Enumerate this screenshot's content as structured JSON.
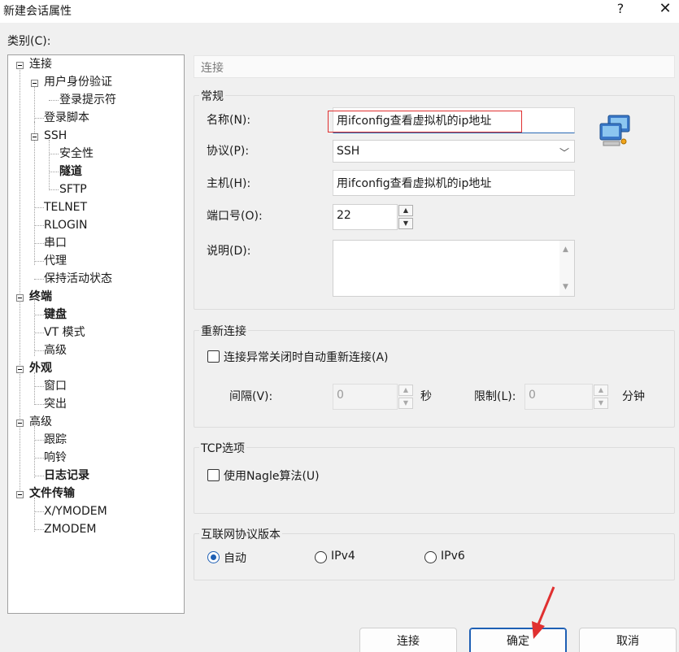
{
  "window": {
    "title": "新建会话属性",
    "help": "?",
    "close": "✕"
  },
  "category_label": "类别(C):",
  "tree": [
    {
      "label": "连接",
      "bold": true
    },
    {
      "label": "用户身份验证",
      "bold": true
    },
    {
      "label": "登录提示符",
      "bold": false
    },
    {
      "label": "登录脚本",
      "bold": false
    },
    {
      "label": "SSH",
      "bold": false
    },
    {
      "label": "安全性",
      "bold": false
    },
    {
      "label": "隧道",
      "bold": true
    },
    {
      "label": "SFTP",
      "bold": false
    },
    {
      "label": "TELNET",
      "bold": false
    },
    {
      "label": "RLOGIN",
      "bold": false
    },
    {
      "label": "串口",
      "bold": false
    },
    {
      "label": "代理",
      "bold": false
    },
    {
      "label": "保持活动状态",
      "bold": false
    },
    {
      "label": "终端",
      "bold": true
    },
    {
      "label": "键盘",
      "bold": true
    },
    {
      "label": "VT 模式",
      "bold": false
    },
    {
      "label": "高级",
      "bold": false
    },
    {
      "label": "外观",
      "bold": true
    },
    {
      "label": "窗口",
      "bold": false
    },
    {
      "label": "突出",
      "bold": false
    },
    {
      "label": "高级",
      "bold": false
    },
    {
      "label": "跟踪",
      "bold": false
    },
    {
      "label": "响铃",
      "bold": false
    },
    {
      "label": "日志记录",
      "bold": true
    },
    {
      "label": "文件传输",
      "bold": true
    },
    {
      "label": "X/YMODEM",
      "bold": false
    },
    {
      "label": "ZMODEM",
      "bold": false
    }
  ],
  "section_header": "连接",
  "general": {
    "title": "常规",
    "name_label": "名称(N):",
    "name_value": "用ifconfig查看虚拟机的ip地址",
    "protocol_label": "协议(P):",
    "protocol_value": "SSH",
    "host_label": "主机(H):",
    "host_value": "用ifconfig查看虚拟机的ip地址",
    "port_label": "端口号(O):",
    "port_value": "22",
    "desc_label": "说明(D):",
    "desc_value": ""
  },
  "reconnect": {
    "title": "重新连接",
    "checkbox_label": "连接异常关闭时自动重新连接(A)",
    "checked": false,
    "interval_label": "间隔(V):",
    "interval_value": "0",
    "interval_unit": "秒",
    "limit_label": "限制(L):",
    "limit_value": "0",
    "limit_unit": "分钟"
  },
  "tcp": {
    "title": "TCP选项",
    "nagle_label": "使用Nagle算法(U)",
    "checked": false
  },
  "ip_version": {
    "title": "互联网协议版本",
    "options": [
      "自动",
      "IPv4",
      "IPv6"
    ],
    "selected": "自动"
  },
  "buttons": {
    "connect": "连接",
    "ok": "确定",
    "cancel": "取消"
  },
  "colors": {
    "accent": "#1e5fb4",
    "annotation_red": "#e03030"
  }
}
